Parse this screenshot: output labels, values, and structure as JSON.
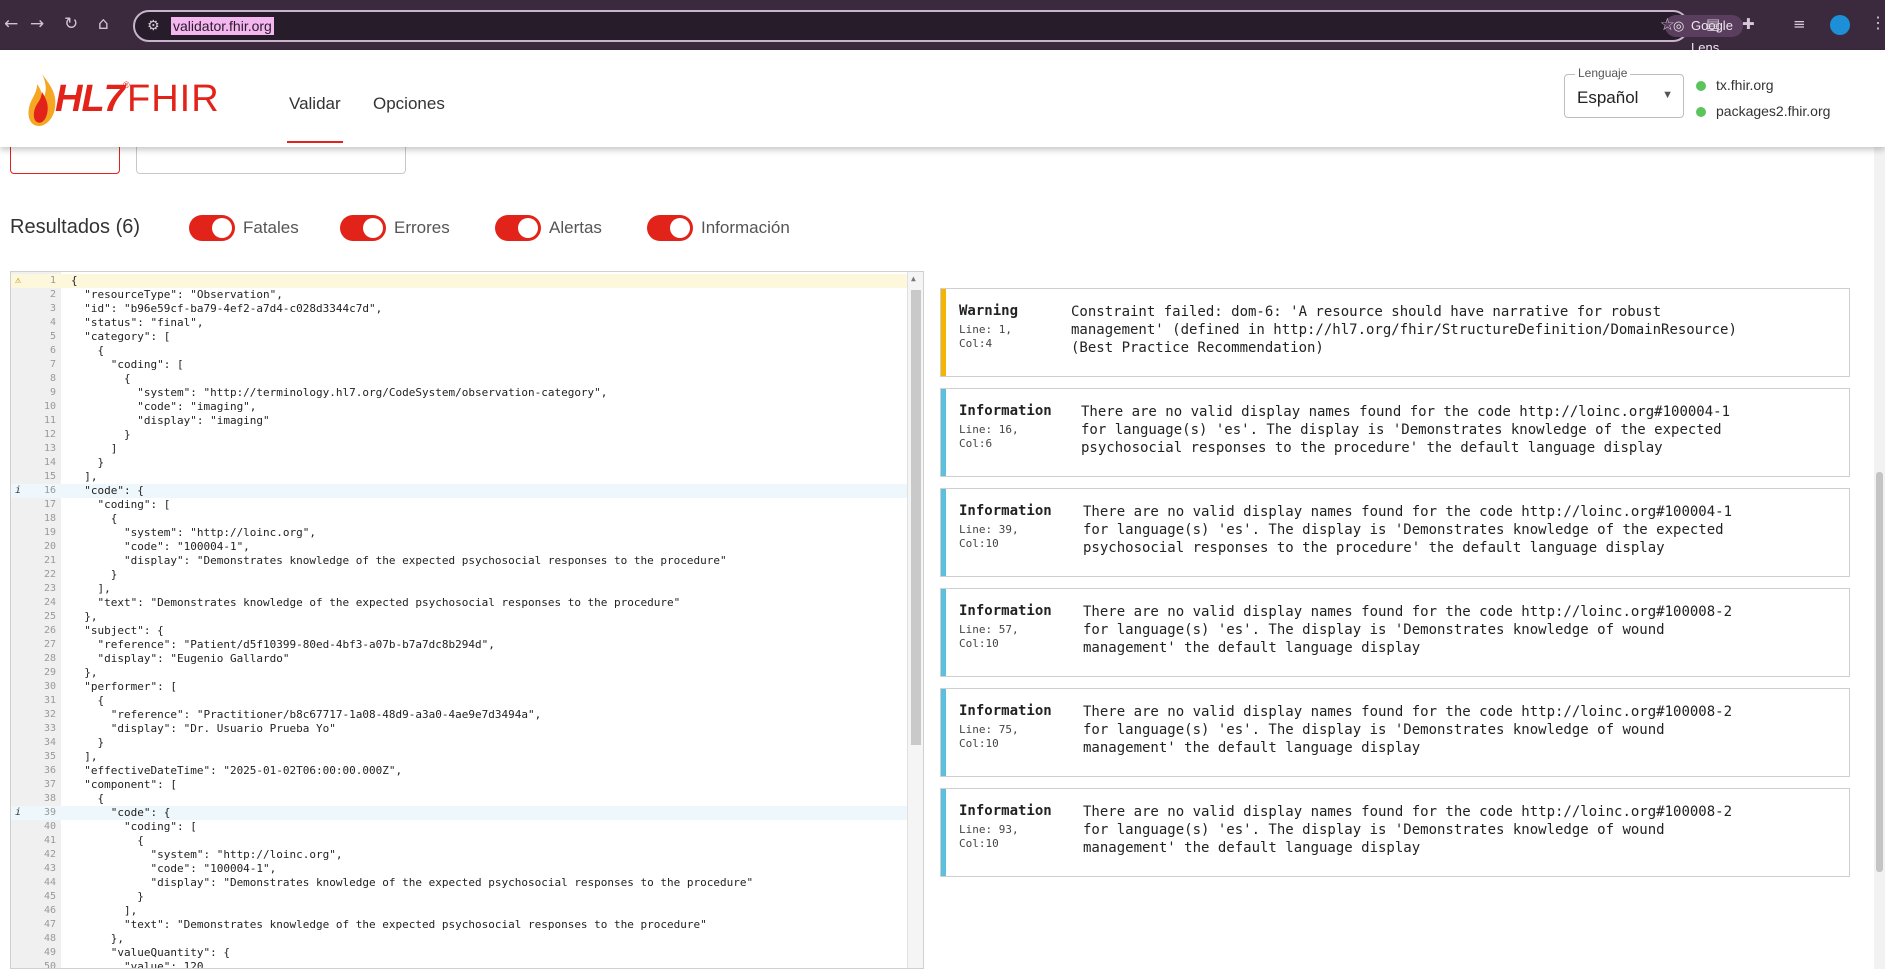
{
  "browser": {
    "url": "validator.fhir.org",
    "lens_label": "Google Lens",
    "icons": [
      "back-icon",
      "forward-icon",
      "reload-icon",
      "home-icon",
      "site-settings-icon",
      "bookmark-star-icon",
      "cast-icon",
      "extensions-icon",
      "media-icon",
      "profile-icon",
      "menu-icon"
    ]
  },
  "header": {
    "logo_hl7": "HL7",
    "logo_fhir": "FHIR",
    "logo_tm": "®",
    "tabs": [
      {
        "label": "Validar",
        "active": true
      },
      {
        "label": "Opciones",
        "active": false
      }
    ],
    "language": {
      "label": "Lenguaje",
      "value": "Español"
    },
    "servers": [
      "tx.fhir.org",
      "packages2.fhir.org"
    ],
    "accent_color": "#e2231a",
    "server_status_color": "#5cc45c"
  },
  "results": {
    "title": "Resultados (6)",
    "filters": [
      {
        "label": "Fatales",
        "on": true
      },
      {
        "label": "Errores",
        "on": true
      },
      {
        "label": "Alertas",
        "on": true
      },
      {
        "label": "Información",
        "on": true
      }
    ]
  },
  "editor": {
    "lines": [
      "{",
      "  \"resourceType\": \"Observation\",",
      "  \"id\": \"b96e59cf-ba79-4ef2-a7d4-c028d3344c7d\",",
      "  \"status\": \"final\",",
      "  \"category\": [",
      "    {",
      "      \"coding\": [",
      "        {",
      "          \"system\": \"http://terminology.hl7.org/CodeSystem/observation-category\",",
      "          \"code\": \"imaging\",",
      "          \"display\": \"imaging\"",
      "        }",
      "      ]",
      "    }",
      "  ],",
      "  \"code\": {",
      "    \"coding\": [",
      "      {",
      "        \"system\": \"http://loinc.org\",",
      "        \"code\": \"100004-1\",",
      "        \"display\": \"Demonstrates knowledge of the expected psychosocial responses to the procedure\"",
      "      }",
      "    ],",
      "    \"text\": \"Demonstrates knowledge of the expected psychosocial responses to the procedure\"",
      "  },",
      "  \"subject\": {",
      "    \"reference\": \"Patient/d5f10399-80ed-4bf3-a07b-b7a7dc8b294d\",",
      "    \"display\": \"Eugenio Gallardo\"",
      "  },",
      "  \"performer\": [",
      "    {",
      "      \"reference\": \"Practitioner/b8c67717-1a08-48d9-a3a0-4ae9e7d3494a\",",
      "      \"display\": \"Dr. Usuario Prueba Yo\"",
      "    }",
      "  ],",
      "  \"effectiveDateTime\": \"2025-01-02T06:00:00.000Z\",",
      "  \"component\": [",
      "    {",
      "      \"code\": {",
      "        \"coding\": [",
      "          {",
      "            \"system\": \"http://loinc.org\",",
      "            \"code\": \"100004-1\",",
      "            \"display\": \"Demonstrates knowledge of the expected psychosocial responses to the procedure\"",
      "          }",
      "        ],",
      "        \"text\": \"Demonstrates knowledge of the expected psychosocial responses to the procedure\"",
      "      },",
      "      \"valueQuantity\": {",
      "        \"value\": 120,"
    ],
    "markers": {
      "1": "warning",
      "16": "info",
      "39": "info"
    },
    "warning_color": "#f5b400",
    "info_color": "#5bc0de"
  },
  "messages": [
    {
      "level": "Warning",
      "line": "Line: 1,",
      "col": "Col:4",
      "text": "Constraint failed: dom-6: 'A resource should have narrative for robust\nmanagement' (defined in http://hl7.org/fhir/StructureDefinition/DomainResource)\n(Best Practice Recommendation)"
    },
    {
      "level": "Information",
      "line": "Line: 16,",
      "col": "Col:6",
      "text": "There are no valid display names found for the code http://loinc.org#100004-1\nfor language(s) 'es'. The display is 'Demonstrates knowledge of the expected\npsychosocial responses to the procedure' the default language display"
    },
    {
      "level": "Information",
      "line": "Line: 39,",
      "col": "Col:10",
      "text": "There are no valid display names found for the code http://loinc.org#100004-1\nfor language(s) 'es'. The display is 'Demonstrates knowledge of the expected\npsychosocial responses to the procedure' the default language display"
    },
    {
      "level": "Information",
      "line": "Line: 57,",
      "col": "Col:10",
      "text": "There are no valid display names found for the code http://loinc.org#100008-2\nfor language(s) 'es'. The display is 'Demonstrates knowledge of wound\nmanagement' the default language display"
    },
    {
      "level": "Information",
      "line": "Line: 75,",
      "col": "Col:10",
      "text": "There are no valid display names found for the code http://loinc.org#100008-2\nfor language(s) 'es'. The display is 'Demonstrates knowledge of wound\nmanagement' the default language display"
    },
    {
      "level": "Information",
      "line": "Line: 93,",
      "col": "Col:10",
      "text": "There are no valid display names found for the code http://loinc.org#100008-2\nfor language(s) 'es'. The display is 'Demonstrates knowledge of wound\nmanagement' the default language display"
    }
  ]
}
